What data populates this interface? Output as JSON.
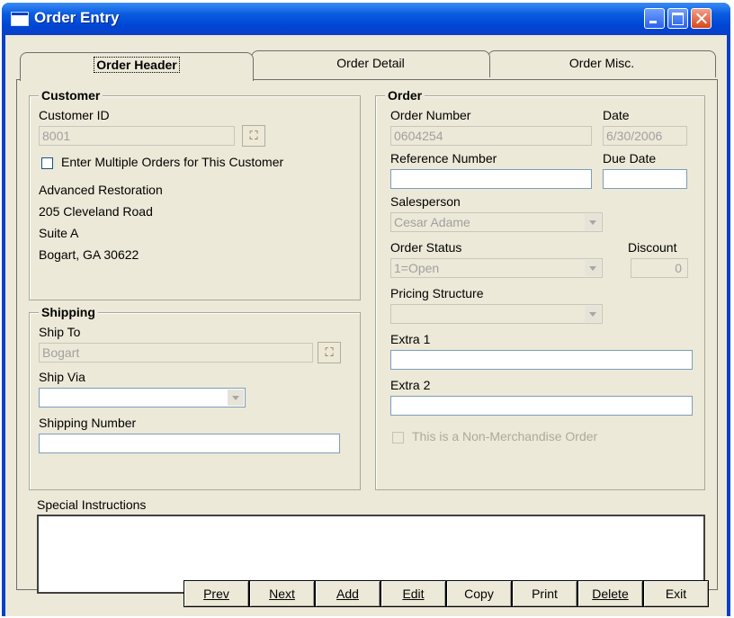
{
  "window": {
    "title": "Order Entry"
  },
  "tabs": [
    {
      "label": "Order Header"
    },
    {
      "label": "Order Detail"
    },
    {
      "label": "Order Misc."
    }
  ],
  "customer": {
    "legend": "Customer",
    "id_label": "Customer ID",
    "id_value": "8001",
    "multi_label": "Enter Multiple Orders for This Customer",
    "address": [
      "Advanced Restoration",
      "205 Cleveland Road",
      "Suite A",
      "Bogart, GA  30622"
    ]
  },
  "shipping": {
    "legend": "Shipping",
    "ship_to_label": "Ship To",
    "ship_to_value": "Bogart",
    "ship_via_label": "Ship Via",
    "ship_via_value": "",
    "number_label": "Shipping Number",
    "number_value": ""
  },
  "order": {
    "legend": "Order",
    "number_label": "Order Number",
    "number_value": "0604254",
    "date_label": "Date",
    "date_value": "6/30/2006",
    "ref_label": "Reference Number",
    "ref_value": "",
    "due_label": "Due Date",
    "due_value": "",
    "salesperson_label": "Salesperson",
    "salesperson_value": "Cesar Adame",
    "status_label": "Order Status",
    "status_value": "1=Open",
    "discount_label": "Discount",
    "discount_value": "0",
    "pricing_label": "Pricing Structure",
    "pricing_value": "",
    "extra1_label": "Extra 1",
    "extra1_value": "",
    "extra2_label": "Extra 2",
    "extra2_value": "",
    "nonmerch_label": "This is a Non-Merchandise Order"
  },
  "special": {
    "label": "Special Instructions",
    "value": ""
  },
  "buttons": [
    "Prev",
    "Next",
    "Add",
    "Edit",
    "Copy",
    "Print",
    "Delete",
    "Exit"
  ]
}
